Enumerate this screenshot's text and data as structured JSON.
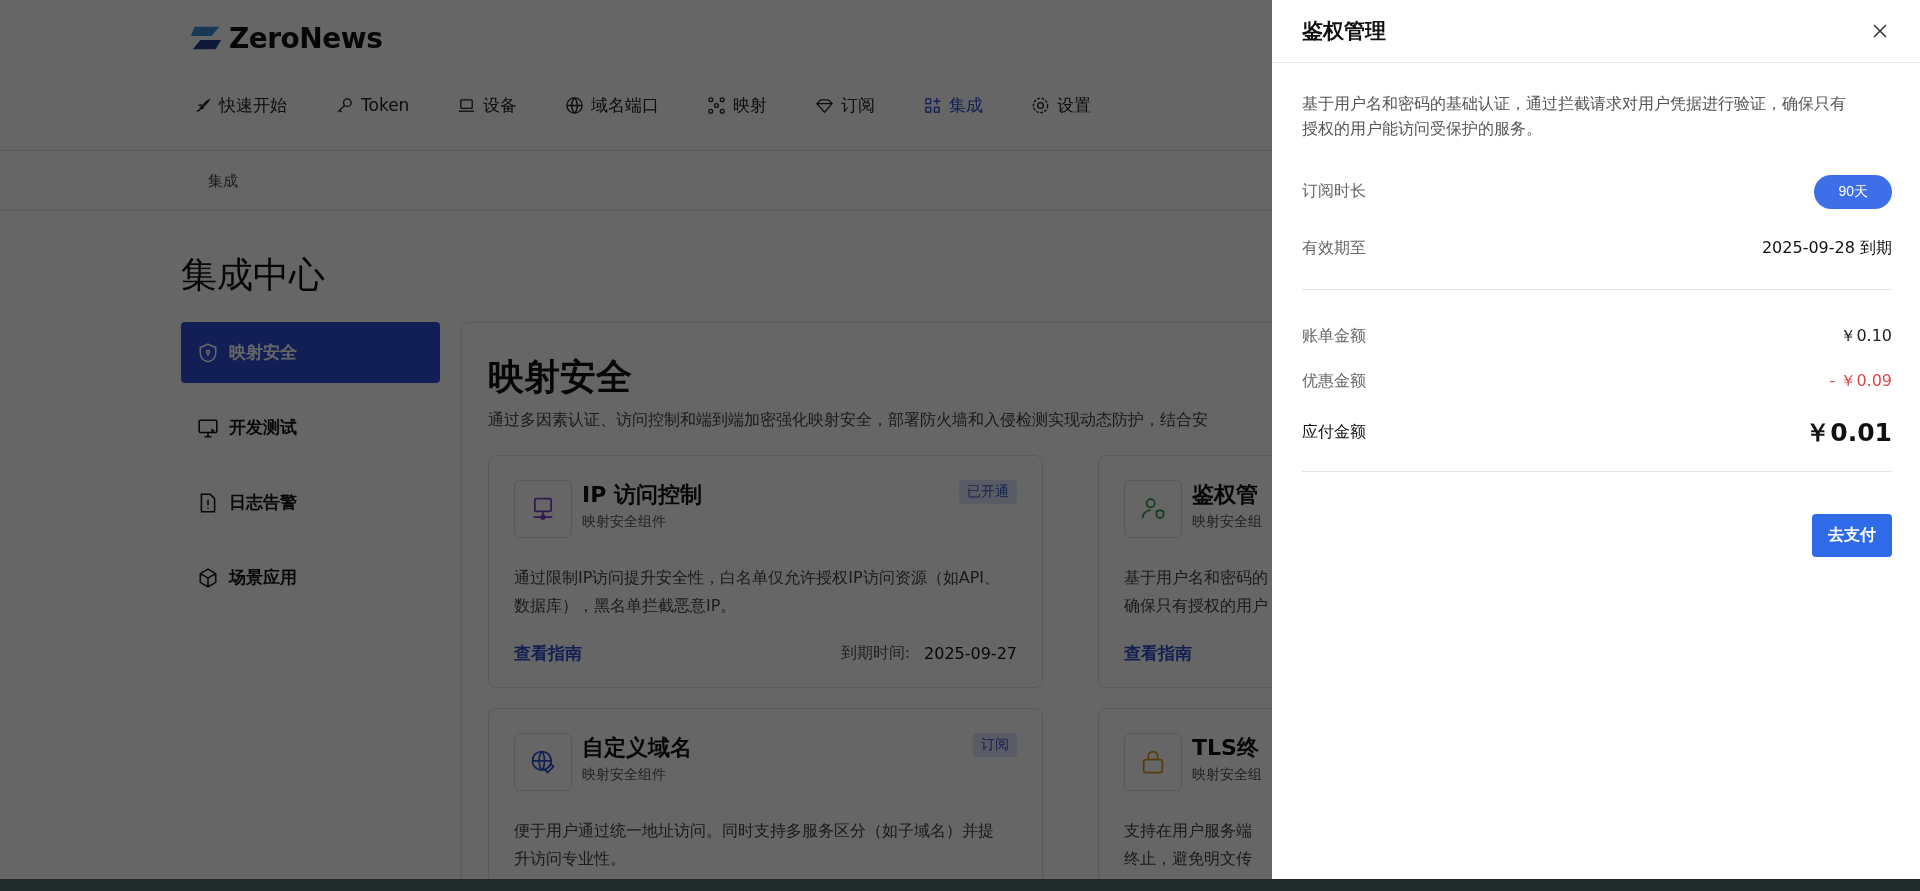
{
  "logo": {
    "text": "ZeroNews"
  },
  "nav": [
    {
      "label": "快速开始",
      "selected": false
    },
    {
      "label": "Token",
      "selected": false
    },
    {
      "label": "设备",
      "selected": false
    },
    {
      "label": "域名端口",
      "selected": false
    },
    {
      "label": "映射",
      "selected": false
    },
    {
      "label": "订阅",
      "selected": false
    },
    {
      "label": "集成",
      "selected": true
    },
    {
      "label": "设置",
      "selected": false
    }
  ],
  "breadcrumb": "集成",
  "page_title": "集成中心",
  "sidebar": [
    {
      "label": "映射安全",
      "selected": true
    },
    {
      "label": "开发测试",
      "selected": false
    },
    {
      "label": "日志告警",
      "selected": false
    },
    {
      "label": "场景应用",
      "selected": false
    }
  ],
  "section": {
    "title": "映射安全",
    "description": "通过多因素认证、访问控制和端到端加密强化映射安全，部署防火墙和入侵检测实现动态防护，结合安"
  },
  "cards": [
    {
      "title": "IP 访问控制",
      "subtitle": "映射安全组件",
      "badge": "已开通",
      "description": [
        "通过限制IP访问提升安全性，白名单仅允许授权IP访问资源（如API、",
        "数据库），黑名单拦截恶意IP。"
      ],
      "link": "查看指南",
      "expiry_label": "到期时间:",
      "expiry": "2025-09-27"
    },
    {
      "title": "鉴权管",
      "subtitle": "映射安全组",
      "description": [
        "基于用户名和密码的",
        "确保只有授权的用户"
      ],
      "link": "查看指南"
    },
    {
      "title": "自定义域名",
      "subtitle": "映射安全组件",
      "badge": "订阅",
      "description": [
        "便于用户通过统一地址访问。同时支持多服务区分（如子域名）并提",
        "升访问专业性。"
      ]
    },
    {
      "title": "TLS终",
      "subtitle": "映射安全组",
      "description": [
        "支持在用户服务端",
        "终止，避免明文传"
      ]
    }
  ],
  "drawer": {
    "title": "鉴权管理",
    "description": "基于用户名和密码的基础认证，通过拦截请求对用户凭据进行验证，确保只有授权的用户能访问受保护的服务。",
    "duration_label": "订阅时长",
    "duration_options": [
      {
        "label": "90天",
        "selected": true
      }
    ],
    "valid_label": "有效期至",
    "valid_value": "2025-09-28 到期",
    "prices": [
      {
        "kind": "normal",
        "label": "账单金额",
        "value": "￥0.10"
      },
      {
        "kind": "discount",
        "label": "优惠金额",
        "value": "- ￥0.09"
      },
      {
        "kind": "total",
        "label": "应付金额",
        "value": "￥0.01"
      }
    ],
    "pay_button": "去支付"
  }
}
